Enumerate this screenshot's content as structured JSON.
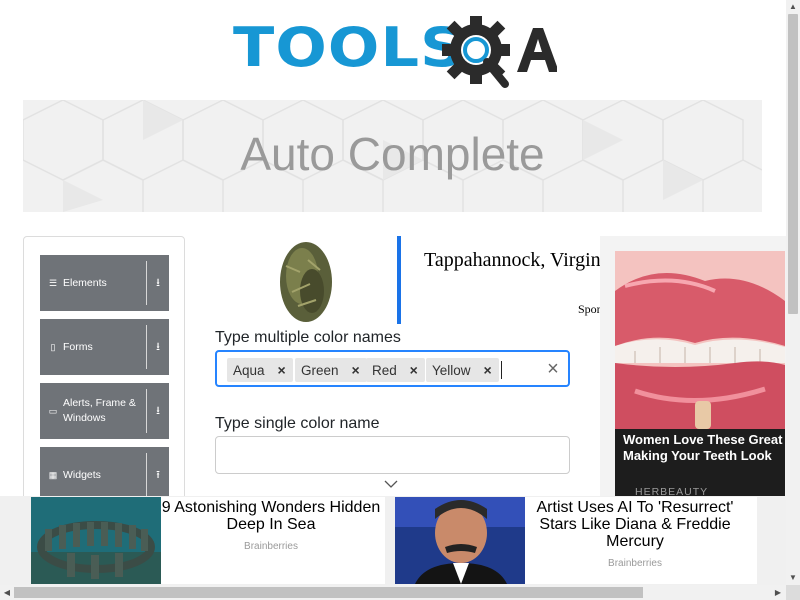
{
  "header": {
    "logo_text": "TOOLS",
    "logo_suffix": "A"
  },
  "banner": {
    "title": "Auto Complete"
  },
  "sidebar": {
    "items": [
      {
        "label": "Elements",
        "icon": "hamburger-icon",
        "arrow": "download-arrow-icon"
      },
      {
        "label": "Forms",
        "icon": "form-icon",
        "arrow": "download-arrow-icon"
      },
      {
        "label": "Alerts, Frame & Windows",
        "icon": "window-icon",
        "arrow": "download-arrow-icon"
      },
      {
        "label": "Widgets",
        "icon": "grid-icon",
        "arrow": "upload-arrow-icon"
      }
    ]
  },
  "top_ad": {
    "title": "Tappahannock, Virginia",
    "sponsor": "Sponsored"
  },
  "form": {
    "multi_label": "Type multiple color names",
    "chips": [
      "Aqua",
      "Green",
      "Red",
      "Yellow"
    ],
    "single_label": "Type single color name",
    "single_value": ""
  },
  "right_ad": {
    "title": "Women Love These Great Making Your Teeth Look",
    "source": "HERBEAUTY"
  },
  "bottom_ads": [
    {
      "title": "9 Astonishing Wonders Hidden Deep In Sea",
      "source": "Brainberries"
    },
    {
      "title": "Artist Uses AI To 'Resurrect' Stars Like Diana & Freddie Mercury",
      "source": "Brainberries"
    }
  ],
  "colors": {
    "accent": "#1797d4",
    "focus_border": "#2684ff",
    "sidebar_item": "#6f7378",
    "chip_bg": "#e6e6e6"
  }
}
